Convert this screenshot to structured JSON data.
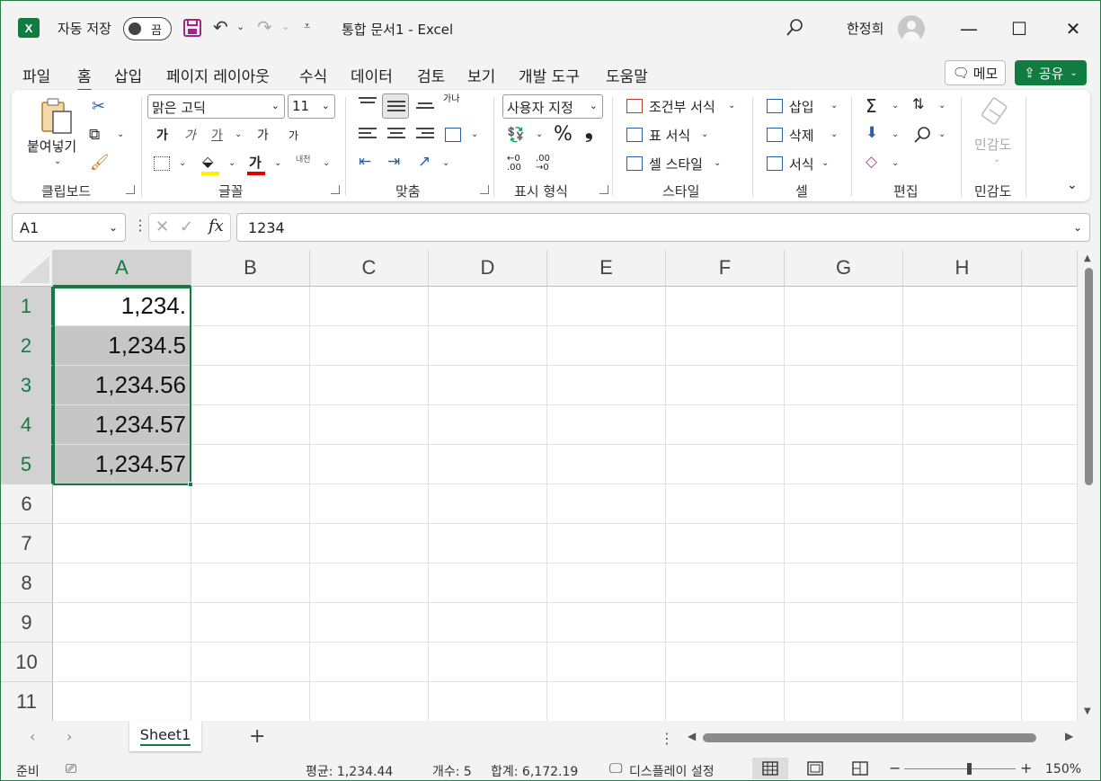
{
  "app": {
    "logo_letter": "X",
    "autosave_label": "자동 저장",
    "autosave_state": "끔",
    "document_title": "통합 문서1  -  Excel",
    "user_name": "한정희"
  },
  "menu": {
    "tabs": [
      "파일",
      "홈",
      "삽입",
      "페이지 레이아웃",
      "수식",
      "데이터",
      "검토",
      "보기",
      "개발 도구",
      "도움말"
    ],
    "active": "홈",
    "memo_label": "메모",
    "share_label": "공유"
  },
  "ribbon": {
    "clipboard": {
      "paste_label": "붙여넣기",
      "group_label": "클립보드"
    },
    "font": {
      "font_name": "맑은 고딕",
      "font_size": "11",
      "bold": "가",
      "italic": "가",
      "underline": "가",
      "grow": "가",
      "shrink": "가",
      "color_letter": "가",
      "phonetic_top": "내천",
      "group_label": "글꼴"
    },
    "alignment": {
      "wrap_text": "가나",
      "group_label": "맞춤"
    },
    "number": {
      "format": "사용자 지정",
      "group_label": "표시 형식",
      "percent": "%",
      "comma": "❟"
    },
    "styles": {
      "conditional": "조건부 서식",
      "table": "표 서식",
      "cell_styles": "셀 스타일",
      "group_label": "스타일"
    },
    "cells": {
      "insert": "삽입",
      "delete": "삭제",
      "format": "서식",
      "group_label": "셀"
    },
    "editing": {
      "group_label": "편집"
    },
    "sensitivity": {
      "label": "민감도",
      "group_label": "민감도"
    }
  },
  "formula_bar": {
    "name_box": "A1",
    "fx": "fx",
    "formula": "1234"
  },
  "grid": {
    "columns": [
      "A",
      "B",
      "C",
      "D",
      "E",
      "F",
      "G",
      "H"
    ],
    "rows": [
      "1",
      "2",
      "3",
      "4",
      "5",
      "6",
      "7",
      "8",
      "9",
      "10",
      "11"
    ],
    "cells": {
      "A1": "1,234.",
      "A2": "1,234.5",
      "A3": "1,234.56",
      "A4": "1,234.57",
      "A5": "1,234.57"
    },
    "selected_column": "A",
    "selected_rows": [
      "1",
      "2",
      "3",
      "4",
      "5"
    ]
  },
  "sheets": {
    "tabs": [
      "Sheet1"
    ],
    "active": "Sheet1",
    "add_label": "+"
  },
  "status": {
    "mode": "준비",
    "average": "평균: 1,234.44",
    "count": "개수: 5",
    "sum": "합계: 6,172.19",
    "display_settings": "디스플레이 설정",
    "zoom_minus": "−",
    "zoom_plus": "+",
    "zoom": "150%"
  },
  "colors": {
    "accent": "#107c41",
    "selection_fill": "#c6c6c6",
    "header_selected": "#d2d2d2"
  }
}
